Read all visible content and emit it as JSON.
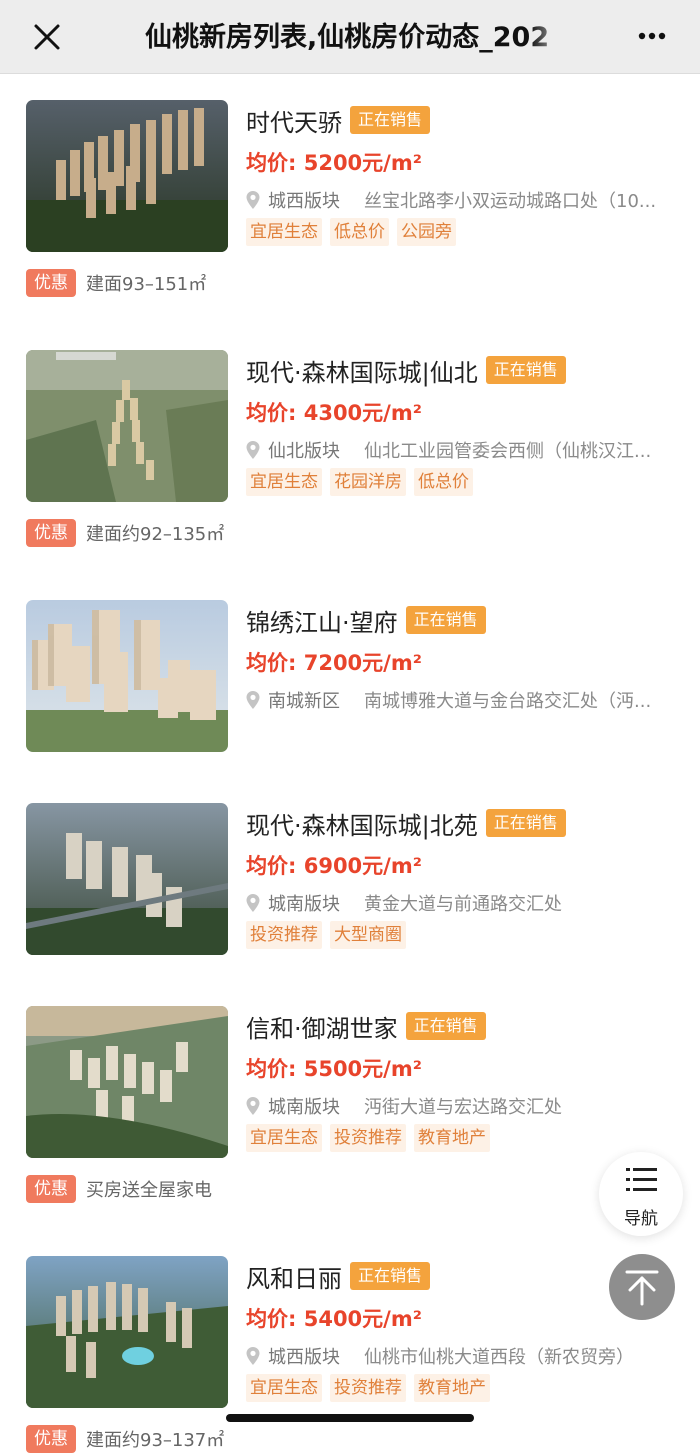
{
  "header": {
    "title": "仙桃新房列表,仙桃房价动态_202",
    "close_icon": "close-icon",
    "more_icon": "more-dots-icon"
  },
  "listings": [
    {
      "name": "时代天骄",
      "status": "正在销售",
      "price_label": "均价:",
      "price": "5200元/m²",
      "district": "城西版块",
      "address": "丝宝北路李小双运动城路口处（10...",
      "tags": [
        "宜居生态",
        "低总价",
        "公园旁"
      ],
      "promo_badge": "优惠",
      "promo_text": "建面93–151㎡"
    },
    {
      "name": "现代·森林国际城|仙北",
      "status": "正在销售",
      "price_label": "均价:",
      "price": "4300元/m²",
      "district": "仙北版块",
      "address": "仙北工业园管委会西侧（仙桃汉江...",
      "tags": [
        "宜居生态",
        "花园洋房",
        "低总价"
      ],
      "promo_badge": "优惠",
      "promo_text": "建面约92–135㎡"
    },
    {
      "name": "锦绣江山·望府",
      "status": "正在销售",
      "price_label": "均价:",
      "price": "7200元/m²",
      "district": "南城新区",
      "address": "南城博雅大道与金台路交汇处（沔...",
      "tags": [],
      "promo_badge": "",
      "promo_text": ""
    },
    {
      "name": "现代·森林国际城|北苑",
      "status": "正在销售",
      "price_label": "均价:",
      "price": "6900元/m²",
      "district": "城南版块",
      "address": "黄金大道与前通路交汇处",
      "tags": [
        "投资推荐",
        "大型商圈"
      ],
      "promo_badge": "",
      "promo_text": ""
    },
    {
      "name": "信和·御湖世家",
      "status": "正在销售",
      "price_label": "均价:",
      "price": "5500元/m²",
      "district": "城南版块",
      "address": "沔街大道与宏达路交汇处",
      "tags": [
        "宜居生态",
        "投资推荐",
        "教育地产"
      ],
      "promo_badge": "优惠",
      "promo_text": "买房送全屋家电"
    },
    {
      "name": "风和日丽",
      "status": "正在销售",
      "price_label": "均价:",
      "price": "5400元/m²",
      "district": "城西版块",
      "address": "仙桃市仙桃大道西段（新农贸旁）",
      "tags": [
        "宜居生态",
        "投资推荐",
        "教育地产"
      ],
      "promo_badge": "优惠",
      "promo_text": "建面约93–137㎡"
    }
  ],
  "floating": {
    "nav_label": "导航",
    "nav_icon": "list-menu-icon",
    "top_icon": "back-to-top-icon"
  },
  "colors": {
    "status_bg": "#f4a33d",
    "price": "#e8442b",
    "tag_bg": "#fdf1e6",
    "tag_text": "#e0803a",
    "promo_bg": "#f07a5e"
  }
}
